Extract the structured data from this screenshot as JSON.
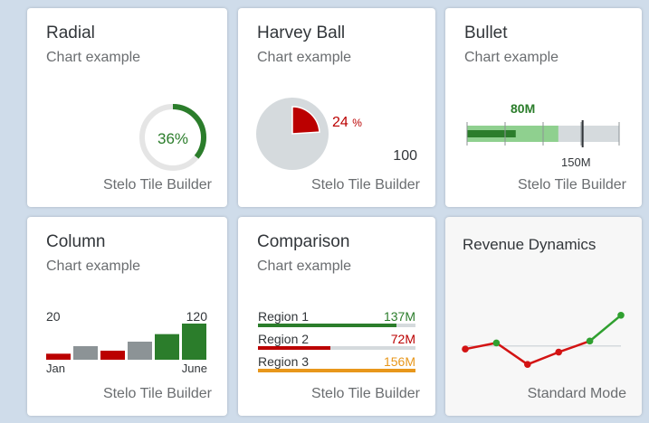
{
  "colors": {
    "good": "#2b7d2b",
    "critical": "#bb0000",
    "neutral": "#d5dadd",
    "neutral_dark": "#8c9396",
    "light_good": "#8fd08f",
    "warning": "#e8971b",
    "text": "#32363a",
    "muted": "#6a6d70"
  },
  "tiles": {
    "radial": {
      "title": "Radial",
      "subtitle": "Chart example",
      "value_text": "36%",
      "percent": 36,
      "footer": "Stelo Tile Builder"
    },
    "harvey": {
      "title": "Harvey Ball",
      "subtitle": "Chart example",
      "fraction_value": "24",
      "fraction_unit": "%",
      "total": "100",
      "fraction": 24,
      "footer": "Stelo Tile Builder"
    },
    "bullet": {
      "title": "Bullet",
      "subtitle": "Chart example",
      "actual_label": "80M",
      "target_label": "150M",
      "footer": "Stelo Tile Builder",
      "actual": 80,
      "forecast": 150,
      "target": 190,
      "max": 250
    },
    "column": {
      "title": "Column",
      "subtitle": "Chart example",
      "left_top_label": "20",
      "right_top_label": "120",
      "left_bottom_label": "Jan",
      "right_bottom_label": "June",
      "footer": "Stelo Tile Builder"
    },
    "comparison": {
      "title": "Comparison",
      "subtitle": "Chart example",
      "footer": "Stelo Tile Builder",
      "items": [
        {
          "label": "Region 1",
          "value_text": "137M",
          "value": 137,
          "color": "#2b7d2b"
        },
        {
          "label": "Region 2",
          "value_text": "72M",
          "value": 72,
          "color": "#bb0000"
        },
        {
          "label": "Region 3",
          "value_text": "156M",
          "value": 156,
          "color": "#e8971b"
        }
      ]
    },
    "revenue": {
      "title": "Revenue Dynamics",
      "footer": "Standard Mode"
    }
  },
  "chart_data": [
    {
      "type": "bar",
      "categories": [
        "Jan",
        "",
        "",
        "",
        "",
        "June"
      ],
      "values": [
        20,
        45,
        30,
        60,
        85,
        120
      ],
      "colors": [
        "#bb0000",
        "#8c9396",
        "#bb0000",
        "#8c9396",
        "#2b7d2b",
        "#2b7d2b"
      ],
      "ylim": [
        0,
        120
      ],
      "xlabel": "",
      "ylabel": ""
    },
    {
      "type": "line",
      "x": [
        1,
        2,
        3,
        4,
        5,
        6
      ],
      "values": [
        35,
        45,
        10,
        30,
        48,
        90
      ],
      "threshold": 40,
      "ylim": [
        0,
        100
      ],
      "xlabel": "",
      "ylabel": ""
    }
  ]
}
